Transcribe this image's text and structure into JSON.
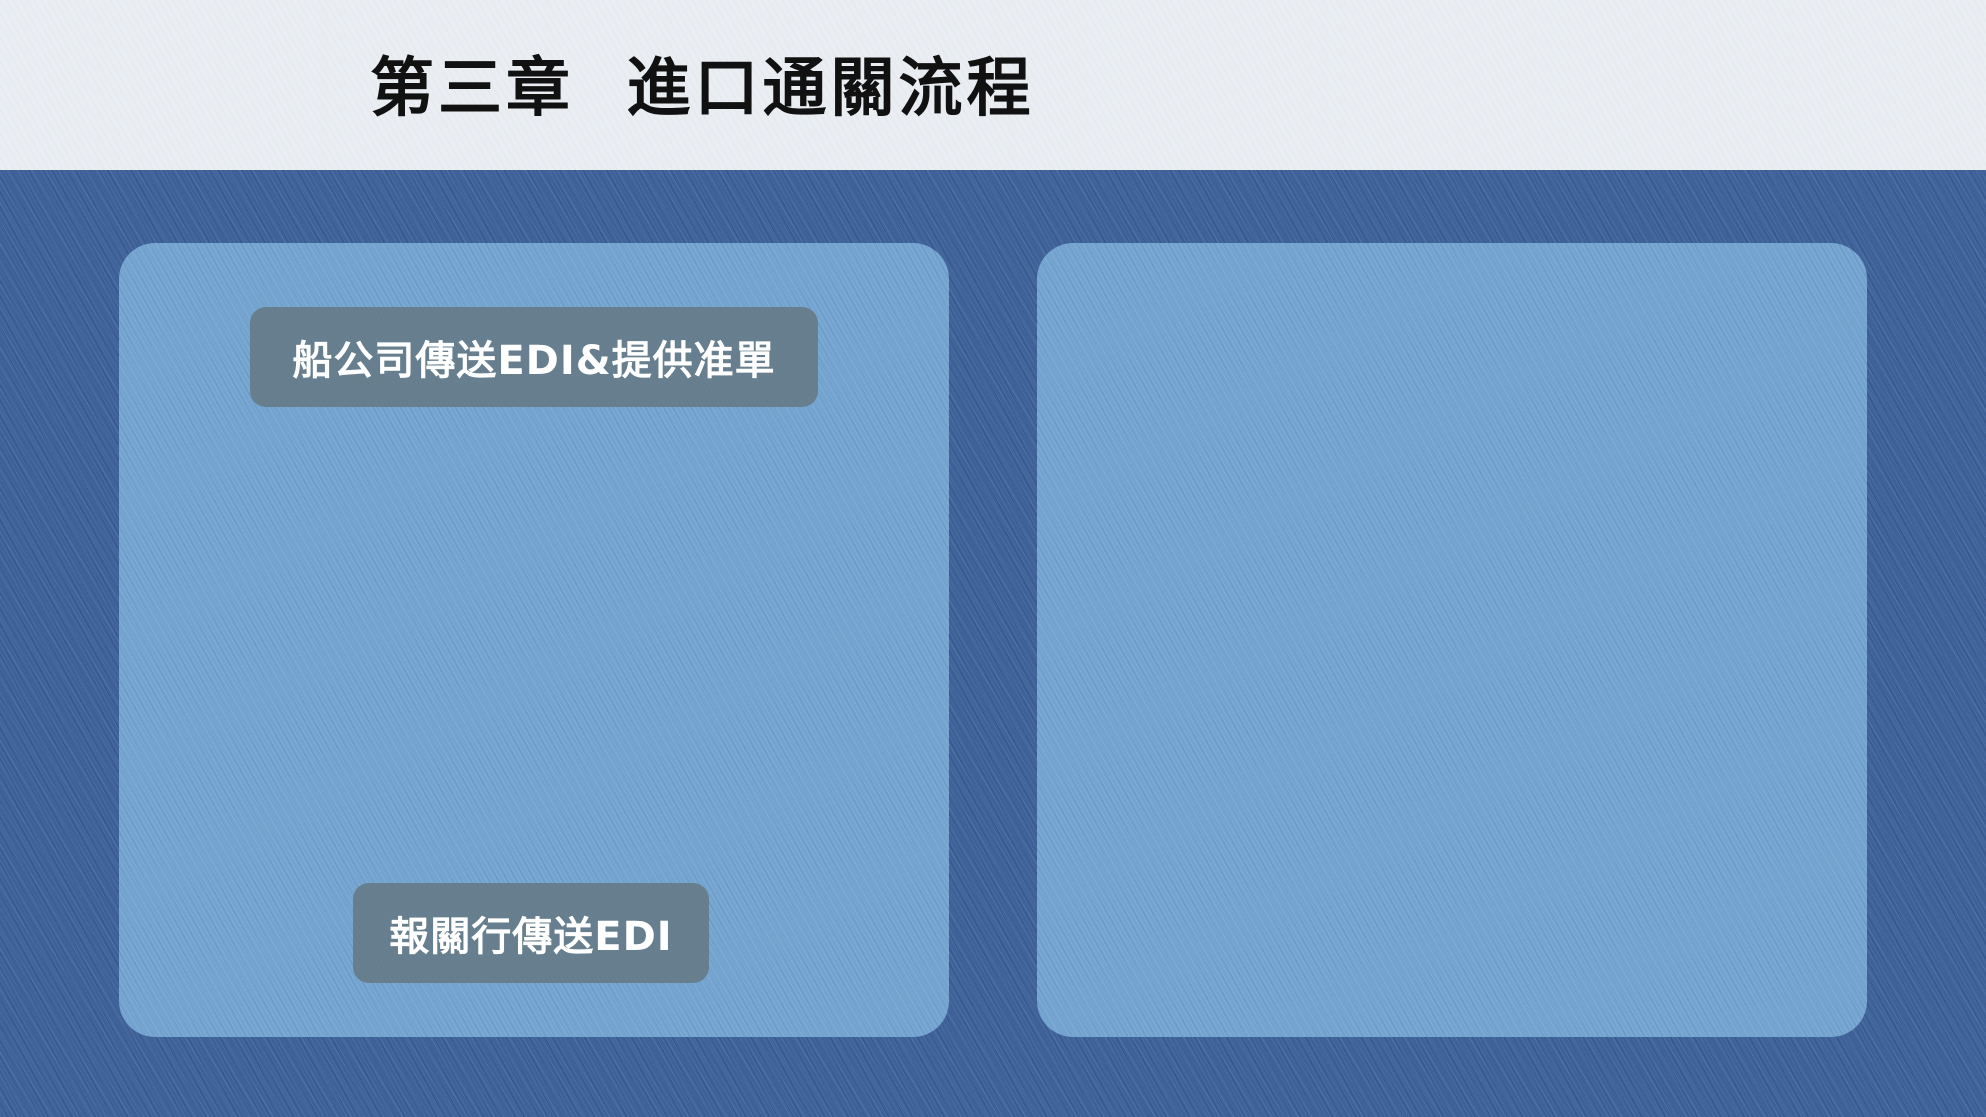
{
  "slide": {
    "title": "第三章  進口通關流程"
  },
  "left_panel": {
    "steps": [
      {
        "label": "船公司傳送EDI&提供准單"
      },
      {
        "label": "報關行傳送EDI"
      }
    ]
  },
  "right_panel": {
    "steps": []
  },
  "colors": {
    "background": "#3d6198",
    "header": "#eaeef2",
    "panel": "#73a3cf",
    "label_box": "#64788a",
    "title_text": "#111111",
    "label_text": "#ffffff"
  }
}
